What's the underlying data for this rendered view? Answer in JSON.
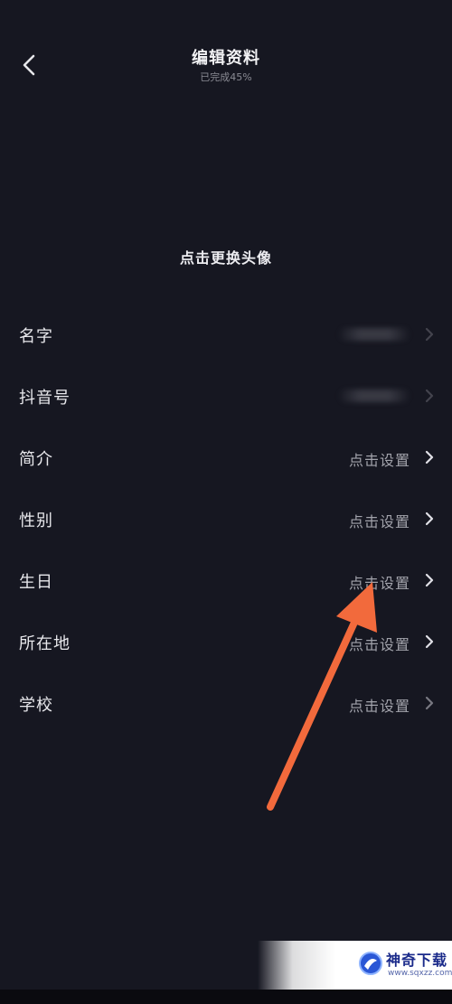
{
  "header": {
    "title": "编辑资料",
    "subtitle": "已完成45%"
  },
  "avatar": {
    "change_label": "点击更换头像"
  },
  "fields": [
    {
      "label": "名字",
      "value": "",
      "blurred": true
    },
    {
      "label": "抖音号",
      "value": "",
      "blurred": true
    },
    {
      "label": "简介",
      "value": "点击设置"
    },
    {
      "label": "性别",
      "value": "点击设置"
    },
    {
      "label": "生日",
      "value": "点击设置"
    },
    {
      "label": "所在地",
      "value": "点击设置"
    },
    {
      "label": "学校",
      "value": "点击设置"
    }
  ],
  "annotation": {
    "arrow_color": "#f26a3c"
  },
  "watermark": {
    "title": "神奇下载",
    "url": "www.sqxzz.com"
  },
  "colors": {
    "background": "#161721",
    "text_primary": "#e8e8ec",
    "text_secondary": "#a2a3ab"
  }
}
